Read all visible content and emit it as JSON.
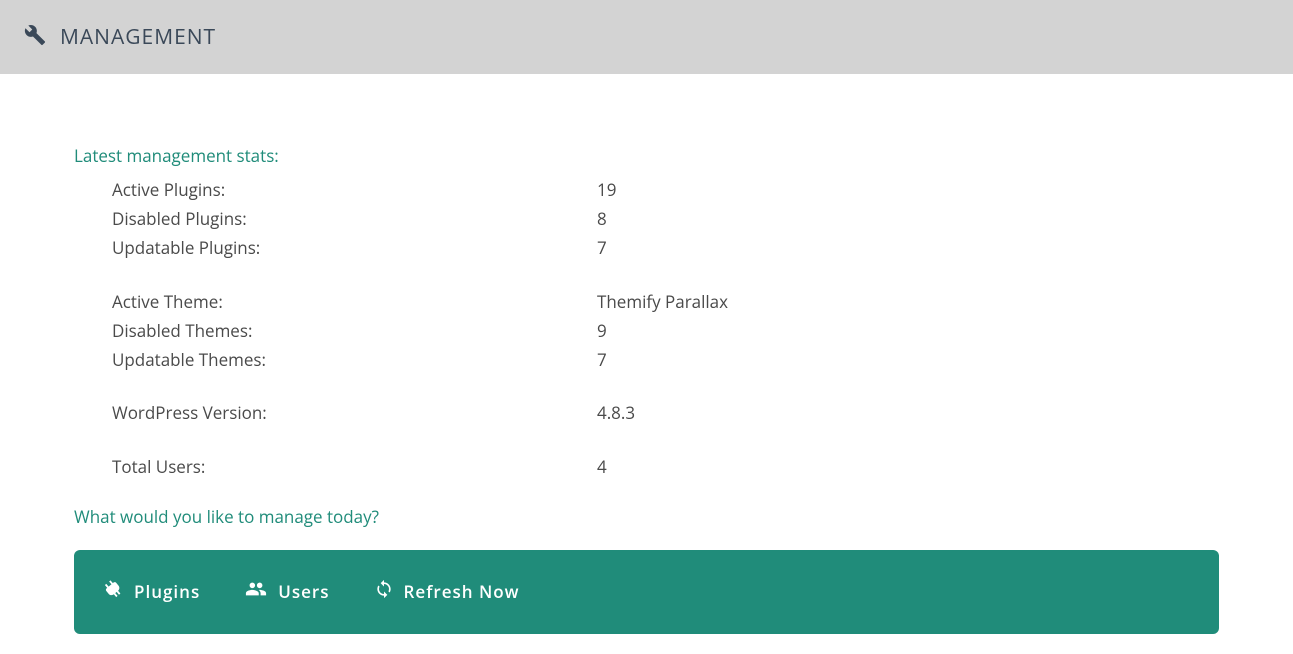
{
  "header": {
    "title": "MANAGEMENT"
  },
  "section_title": "Latest management stats:",
  "stats": {
    "group1": [
      {
        "label": "Active Plugins:",
        "value": "19"
      },
      {
        "label": "Disabled Plugins:",
        "value": "8"
      },
      {
        "label": "Updatable Plugins:",
        "value": "7"
      }
    ],
    "group2": [
      {
        "label": "Active Theme:",
        "value": "Themify Parallax"
      },
      {
        "label": "Disabled Themes:",
        "value": "9"
      },
      {
        "label": "Updatable Themes:",
        "value": "7"
      }
    ],
    "group3": [
      {
        "label": "WordPress Version:",
        "value": "4.8.3"
      }
    ],
    "group4": [
      {
        "label": "Total Users:",
        "value": "4"
      }
    ]
  },
  "question": "What would you like to manage today?",
  "actions": {
    "plugins": "Plugins",
    "users": "Users",
    "refresh": "Refresh Now"
  }
}
